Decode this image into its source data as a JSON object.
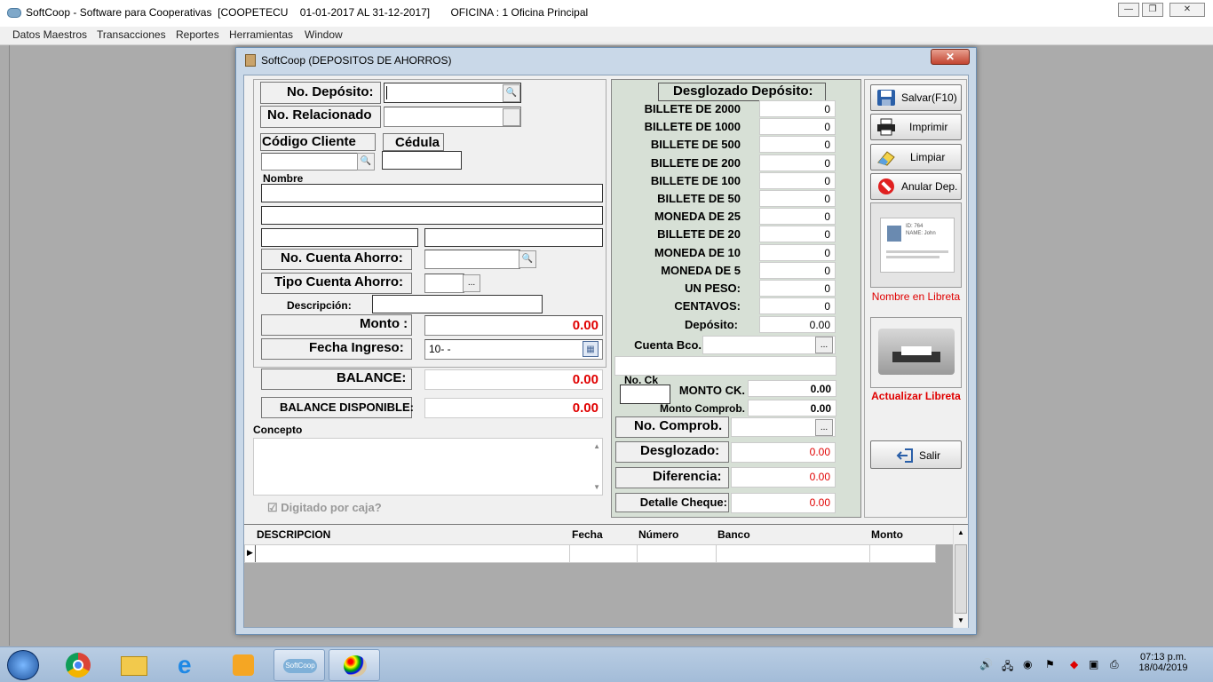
{
  "window": {
    "title": "SoftCoop - Software para Cooperativas  [COOPETECU    01-01-2017 AL 31-12-2017]       OFICINA : 1 Oficina Principal"
  },
  "menu": [
    "Datos Maestros",
    "Transacciones",
    "Reportes",
    "Herramientas",
    "Window"
  ],
  "dialog": {
    "title": "SoftCoop (DEPOSITOS DE AHORROS)",
    "close": "✕"
  },
  "form": {
    "no_deposito_label": "No. Depósito:",
    "no_deposito_value": "",
    "no_relacionado_label": "No. Relacionado",
    "no_relacionado_value": "",
    "codigo_cliente_label": "Código Cliente",
    "cedula_label": "Cédula",
    "nombre_label": "Nombre",
    "no_cuenta_label": "No. Cuenta Ahorro:",
    "tipo_cuenta_label": "Tipo Cuenta Ahorro:",
    "descripcion_label": "Descripción:",
    "monto_label": "Monto :",
    "monto_value": "0.00",
    "fecha_label": "Fecha Ingreso:",
    "fecha_value": "10-  -",
    "balance_label": "BALANCE:",
    "balance_value": "0.00",
    "balance_disp_label": "BALANCE DISPONIBLE:",
    "balance_disp_value": "0.00",
    "concepto_label": "Concepto",
    "digitado_label": "Digitado por caja?"
  },
  "desglose": {
    "title": "Desglozado Depósito:",
    "rows": [
      {
        "label": "BILLETE DE 2000",
        "value": "0"
      },
      {
        "label": "BILLETE DE 1000",
        "value": "0"
      },
      {
        "label": "BILLETE DE 500",
        "value": "0"
      },
      {
        "label": "BILLETE DE 200",
        "value": "0"
      },
      {
        "label": "BILLETE DE 100",
        "value": "0"
      },
      {
        "label": "BILLETE DE 50",
        "value": "0"
      },
      {
        "label": "MONEDA DE 25",
        "value": "0"
      },
      {
        "label": "BILLETE DE 20",
        "value": "0"
      },
      {
        "label": "MONEDA DE 10",
        "value": "0"
      },
      {
        "label": "MONEDA DE 5",
        "value": "0"
      },
      {
        "label": "UN PESO:",
        "value": "0"
      },
      {
        "label": "CENTAVOS:",
        "value": "0"
      }
    ],
    "deposito_label": "Depósito:",
    "deposito_value": "0.00",
    "cuenta_bco_label": "Cuenta Bco.",
    "no_ck_label": "No. Ck",
    "monto_ck_label": "MONTO CK.",
    "monto_ck_value": "0.00",
    "monto_comprob_label": "Monto Comprob.",
    "monto_comprob_value": "0.00",
    "no_comprob_label": "No. Comprob.",
    "desglozado_label": "Desglozado:",
    "desglozado_value": "0.00",
    "diferencia_label": "Diferencia:",
    "diferencia_value": "0.00",
    "detalle_label": "Detalle Cheque:",
    "detalle_value": "0.00"
  },
  "buttons": {
    "salvar": "Salvar(F10)",
    "imprimir": "Imprimir",
    "limpiar": "Limpiar",
    "anular": "Anular Dep.",
    "nombre_libreta": "Nombre en Libreta",
    "actualizar_libreta": "Actualizar Libreta",
    "salir": "Salir",
    "dots": "...",
    "card_id": "ID: 764",
    "card_name": "NAME: John"
  },
  "grid": {
    "columns": [
      "DESCRIPCION",
      "Fecha",
      "Número",
      "Banco",
      "Monto"
    ]
  },
  "tray": {
    "time": "07:13 p.m.",
    "date": "18/04/2019"
  },
  "taskbar": {
    "softcoop": "SoftCoop"
  }
}
